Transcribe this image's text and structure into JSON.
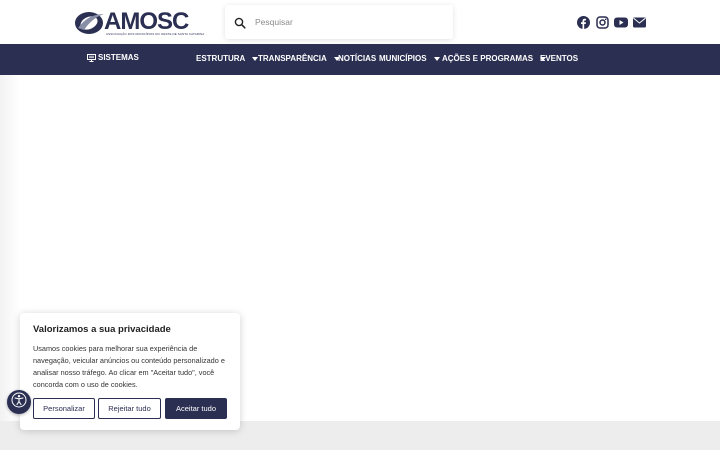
{
  "header": {
    "logo_text": "AMOSC",
    "logo_subtitle": "ASSOCIAÇÃO DOS MUNICÍPIOS DO OESTE DE SANTA CATARINA",
    "search_placeholder": "Pesquisar",
    "social_icons": [
      "facebook-icon",
      "instagram-icon",
      "youtube-icon",
      "envelope-icon"
    ]
  },
  "nav": {
    "sistemas": "SISTEMAS",
    "items": [
      {
        "label": "ESTRUTURA",
        "has_dropdown": true
      },
      {
        "label": "TRANSPARÊNCIA",
        "has_dropdown": true
      },
      {
        "label": "NOTÍCIAS",
        "has_dropdown": false
      },
      {
        "label": "MUNICÍPIOS",
        "has_dropdown": true
      },
      {
        "label": "AÇÕES E PROGRAMAS",
        "has_dropdown": true
      },
      {
        "label": "EVENTOS",
        "has_dropdown": false
      }
    ]
  },
  "cookie": {
    "title": "Valorizamos a sua privacidade",
    "body": "Usamos cookies para melhorar sua experiência de navegação, veicular anúncios ou conteúdo personalizado e analisar nosso tráfego. Ao clicar em \"Aceitar tudo\", você concorda com o uso de cookies.",
    "customize": "Personalizar",
    "reject": "Rejeitar tudo",
    "accept": "Aceitar tudo"
  },
  "colors": {
    "brand_navy": "#2b2f52",
    "white": "#ffffff",
    "footer_gray": "#ededed"
  }
}
